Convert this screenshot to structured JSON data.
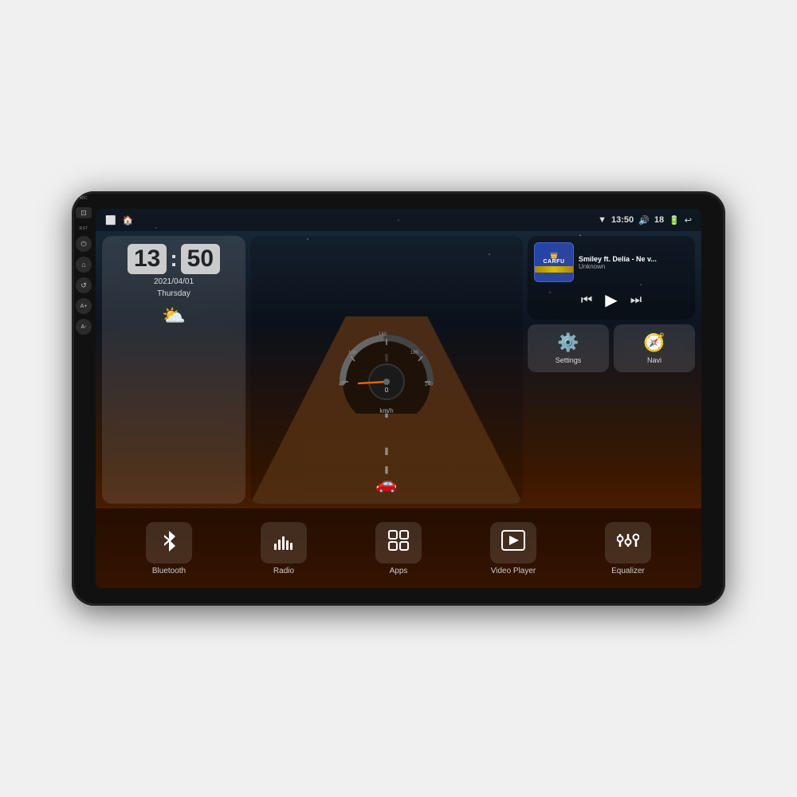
{
  "device": {
    "title": "Car Android Head Unit"
  },
  "status_bar": {
    "left_icons": [
      "home-square-icon",
      "home-icon"
    ],
    "time": "13:50",
    "wifi_icon": "wifi-icon",
    "volume_label": "18",
    "battery_icon": "battery-icon",
    "back_icon": "back-icon"
  },
  "clock": {
    "hour": "13",
    "minute": "50",
    "date": "2021/04/01",
    "day": "Thursday"
  },
  "speedometer": {
    "speed": "0",
    "unit": "km/h",
    "max": "240"
  },
  "music": {
    "title": "Smiley ft. Delia - Ne v...",
    "artist": "Unknown",
    "album_label": "CARFU"
  },
  "widgets": {
    "settings_label": "Settings",
    "navi_label": "Navi"
  },
  "bottom_bar": {
    "buttons": [
      {
        "id": "bluetooth",
        "label": "Bluetooth",
        "icon": "bluetooth-icon"
      },
      {
        "id": "radio",
        "label": "Radio",
        "icon": "radio-icon"
      },
      {
        "id": "apps",
        "label": "Apps",
        "icon": "apps-icon"
      },
      {
        "id": "video-player",
        "label": "Video Player",
        "icon": "video-player-icon"
      },
      {
        "id": "equalizer",
        "label": "Equalizer",
        "icon": "equalizer-icon"
      }
    ]
  },
  "side_panel": {
    "mic_label": "MIC",
    "rst_label": "RST",
    "buttons": [
      {
        "id": "power",
        "icon": "⏻"
      },
      {
        "id": "home",
        "icon": "⌂"
      },
      {
        "id": "back",
        "icon": "↺"
      },
      {
        "id": "vol-up",
        "icon": "A+"
      },
      {
        "id": "vol-down",
        "icon": "A-"
      }
    ]
  }
}
